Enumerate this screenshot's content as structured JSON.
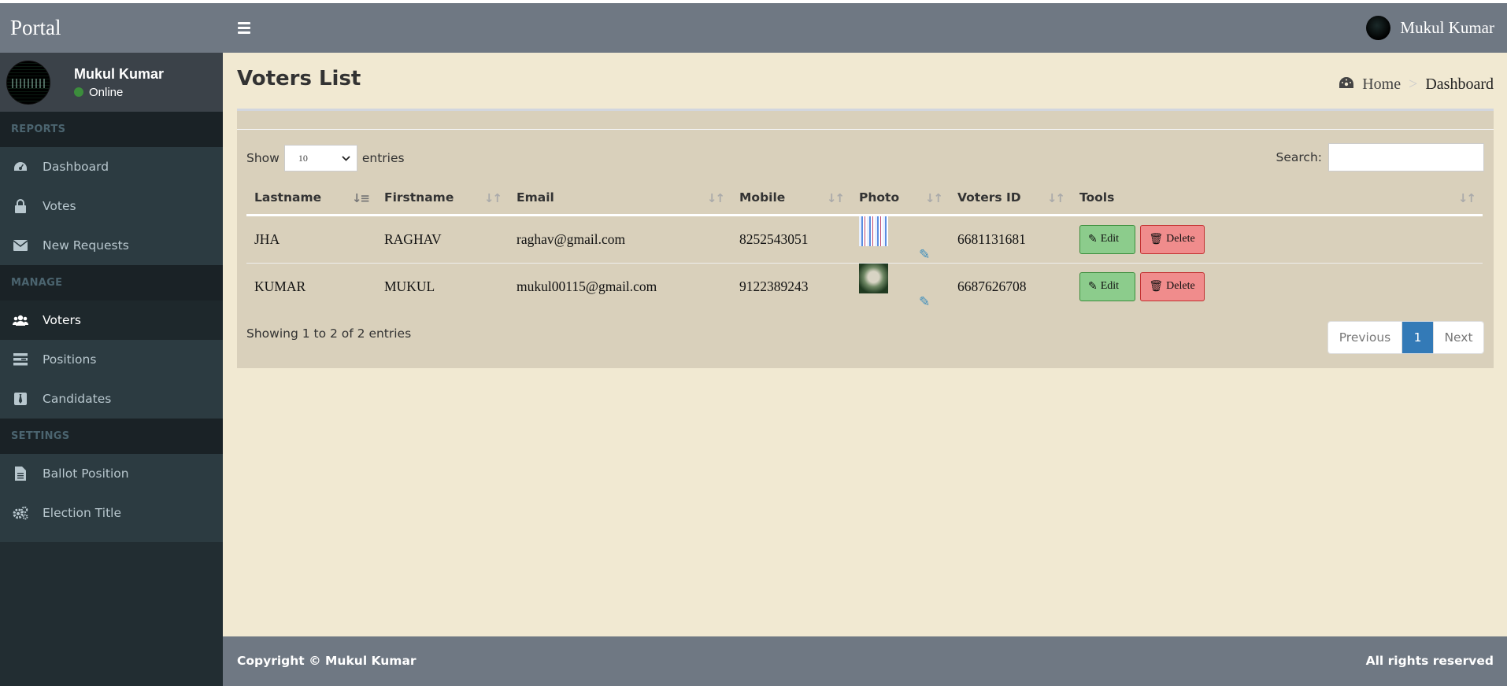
{
  "header": {
    "brand": "Portal",
    "user_name": "Mukul Kumar"
  },
  "sidebar": {
    "user": {
      "name": "Mukul Kumar",
      "status": "Online"
    },
    "sections": [
      {
        "title": "REPORTS",
        "items": [
          {
            "label": "Dashboard",
            "icon": "dashboard-icon"
          },
          {
            "label": "Votes",
            "icon": "lock-icon"
          },
          {
            "label": "New Requests",
            "icon": "envelope-icon"
          }
        ]
      },
      {
        "title": "MANAGE",
        "items": [
          {
            "label": "Voters",
            "icon": "users-icon",
            "active": true
          },
          {
            "label": "Positions",
            "icon": "tasks-icon"
          },
          {
            "label": "Candidates",
            "icon": "tie-icon"
          }
        ]
      },
      {
        "title": "SETTINGS",
        "items": [
          {
            "label": "Ballot Position",
            "icon": "file-icon"
          },
          {
            "label": "Election Title",
            "icon": "cogs-icon"
          }
        ]
      }
    ]
  },
  "main": {
    "title": "Voters List",
    "breadcrumb": {
      "home": "Home",
      "separator": ">",
      "current": "Dashboard"
    },
    "controls": {
      "show": "Show",
      "entries_value": "10",
      "entries": "entries",
      "search_label": "Search:",
      "search_value": ""
    },
    "table": {
      "columns": [
        "Lastname",
        "Firstname",
        "Email",
        "Mobile",
        "Photo",
        "Voters ID",
        "Tools"
      ],
      "rows": [
        {
          "lastname": "JHA",
          "firstname": "RAGHAV",
          "email": "raghav@gmail.com",
          "mobile": "8252543051",
          "voters_id": "6681131681"
        },
        {
          "lastname": "KUMAR",
          "firstname": "MUKUL",
          "email": "mukul00115@gmail.com",
          "mobile": "9122389243",
          "voters_id": "6687626708"
        }
      ],
      "edit_label": "Edit",
      "delete_label": "Delete"
    },
    "info": "Showing 1 to 2 of 2 entries",
    "pagination": {
      "previous": "Previous",
      "current": "1",
      "next": "Next"
    }
  },
  "footer": {
    "copyright": "Copyright © Mukul Kumar",
    "rights": "All rights reserved"
  },
  "colors": {
    "header": "#6f7883",
    "sidebar": "#222d32",
    "content_bg": "#f1e9d2",
    "box_bg": "#d9d0bb",
    "edit": "#8ccc8c",
    "delete": "#f08c8c",
    "page_active": "#337ab7"
  }
}
